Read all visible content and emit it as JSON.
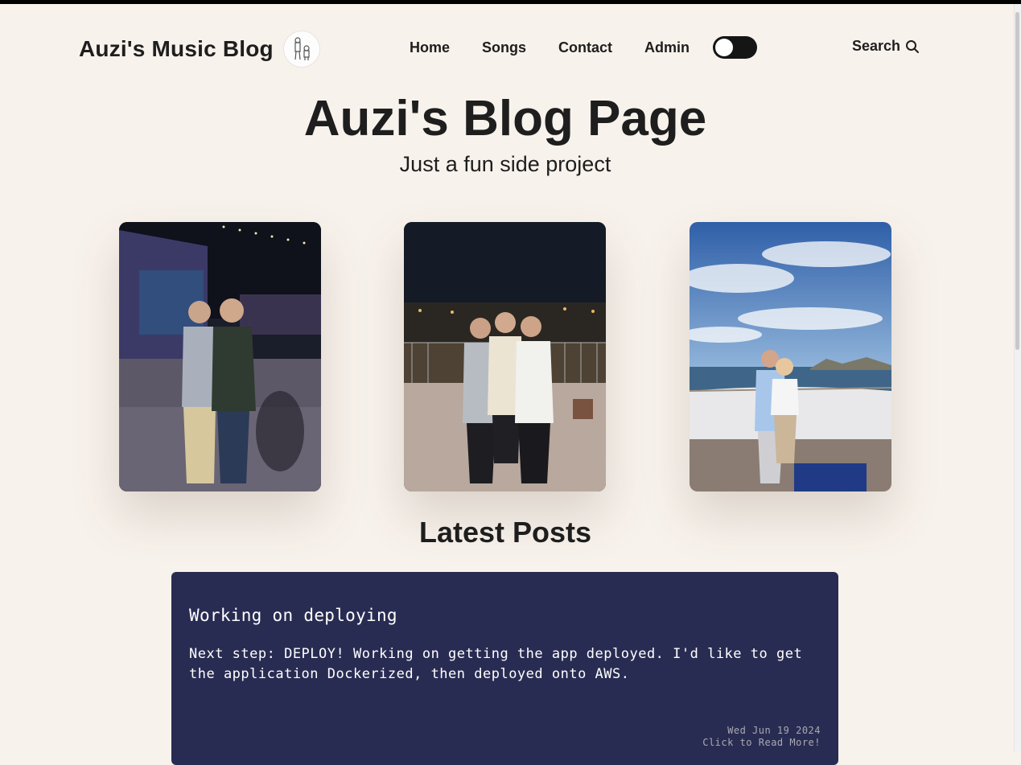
{
  "header": {
    "brand_title": "Auzi's Music Blog",
    "nav": [
      "Home",
      "Songs",
      "Contact",
      "Admin"
    ],
    "search_label": "Search",
    "theme_toggle": "dark-mode-toggle"
  },
  "hero": {
    "title": "Auzi's Blog Page",
    "subtitle": "Just a fun side project"
  },
  "photos": [
    {
      "icon": "photo-concert-night"
    },
    {
      "icon": "photo-terrace-night"
    },
    {
      "icon": "photo-boat-deck"
    }
  ],
  "latest": {
    "heading": "Latest Posts",
    "posts": [
      {
        "title": "Working on deploying",
        "body": "Next step: DEPLOY! Working on getting the app deployed. I'd like to get the application Dockerized, then deployed onto AWS.",
        "date": "Wed Jun 19 2024",
        "cta": "Click to Read More!"
      }
    ]
  },
  "colors": {
    "background": "#f8f2ec",
    "card": "#292c52",
    "text": "#1e1e1e"
  }
}
